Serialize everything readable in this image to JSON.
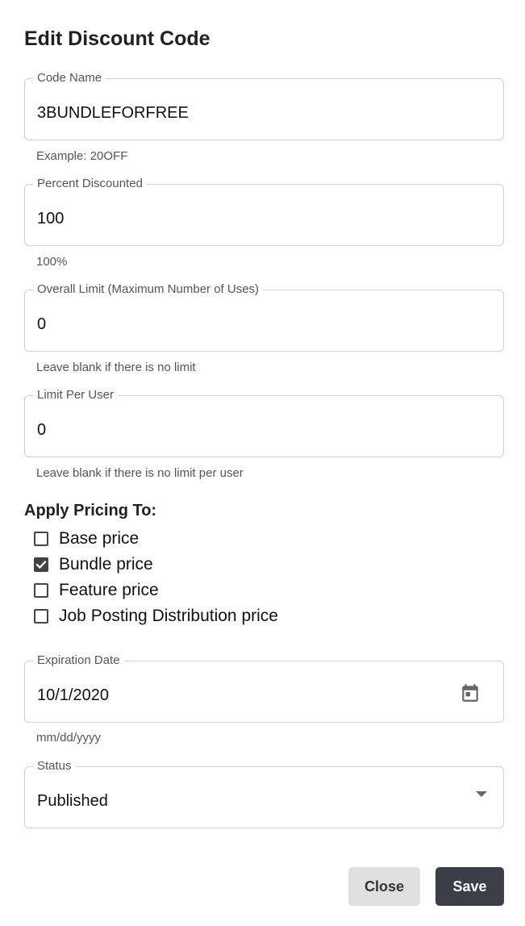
{
  "dialog": {
    "title": "Edit Discount Code"
  },
  "fields": {
    "code_name": {
      "label": "Code Name",
      "value": "3BUNDLEFORFREE",
      "helper": "Example: 20OFF"
    },
    "percent": {
      "label": "Percent Discounted",
      "value": "100",
      "helper": "100%"
    },
    "overall_limit": {
      "label": "Overall Limit (Maximum Number of Uses)",
      "value": "0",
      "helper": "Leave blank if there is no limit"
    },
    "user_limit": {
      "label": "Limit Per User",
      "value": "0",
      "helper": "Leave blank if there is no limit per user"
    },
    "expiration": {
      "label": "Expiration Date",
      "value": "10/1/2020",
      "helper": "mm/dd/yyyy",
      "icon": "calendar-icon"
    },
    "status": {
      "label": "Status",
      "value": "Published",
      "icon": "dropdown-arrow-icon"
    }
  },
  "pricing": {
    "title": "Apply Pricing To:",
    "options": [
      {
        "label": "Base price",
        "checked": false
      },
      {
        "label": "Bundle price",
        "checked": true
      },
      {
        "label": "Feature price",
        "checked": false
      },
      {
        "label": "Job Posting Distribution price",
        "checked": false
      }
    ]
  },
  "actions": {
    "close_label": "Close",
    "save_label": "Save"
  },
  "colors": {
    "save_bg": "#3d3f48",
    "close_bg": "#e0e0e0",
    "checkbox_checked": "#424242"
  }
}
